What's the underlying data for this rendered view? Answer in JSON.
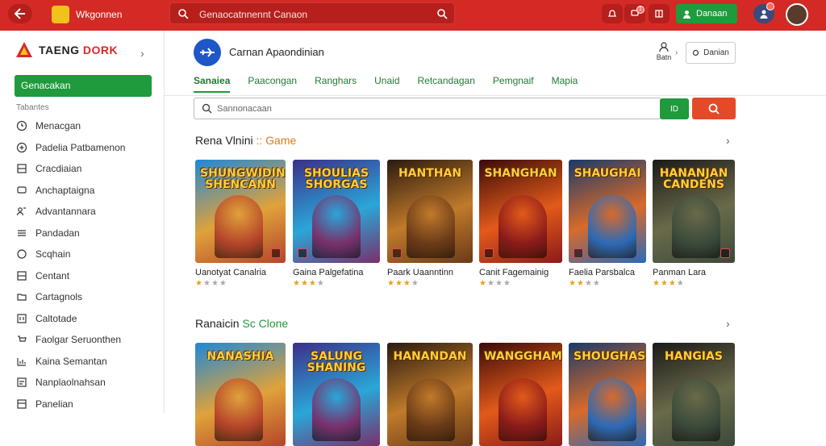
{
  "topbar": {
    "app_name": "Wkgonnen",
    "search_placeholder": "Genaocatnnennt Canaon",
    "signin_label": "Danaan",
    "notif_count": "1"
  },
  "sidebar": {
    "brand_a": "TAENG",
    "brand_b": "DORK",
    "active_item": "Genacakan",
    "section_label": "Tabantes",
    "items": [
      {
        "label": "Menacgan",
        "icon": "clock-icon"
      },
      {
        "label": "Padelia Patbamenon",
        "icon": "plus-circle-icon"
      },
      {
        "label": "Cracdiaian",
        "icon": "grid-icon"
      },
      {
        "label": "Anchaptaigna",
        "icon": "chat-icon"
      },
      {
        "label": "Advantannara",
        "icon": "users-icon"
      },
      {
        "label": "Pandadan",
        "icon": "list-icon"
      },
      {
        "label": "Scqhain",
        "icon": "refresh-icon"
      },
      {
        "label": "Centant",
        "icon": "grid-icon"
      },
      {
        "label": "Cartagnols",
        "icon": "folder-icon"
      },
      {
        "label": "Caltotade",
        "icon": "sliders-icon"
      },
      {
        "label": "Faolgar Seruonthen",
        "icon": "cart-icon"
      },
      {
        "label": "Kaina Semantan",
        "icon": "chart-icon"
      },
      {
        "label": "Nanplaolnahsan",
        "icon": "bars-icon"
      },
      {
        "label": "Panelian",
        "icon": "panel-icon"
      }
    ]
  },
  "header": {
    "title": "Carnan Apaondinian",
    "user_label": "Batn",
    "action_label": "Danian",
    "tabs": [
      "Sanaiea",
      "Paacongan",
      "Ranghars",
      "Unaid",
      "Retcandagan",
      "Pemgnaif",
      "Mapia"
    ]
  },
  "search": {
    "placeholder": "Sannonacaan",
    "green_btn": "ID"
  },
  "sections": [
    {
      "title_a": "Rena Vlnini",
      "title_b": ":: Game",
      "games": [
        {
          "art_title": "SHUNGWIDIN SHENCANN",
          "name": "Uanotyat Canalria",
          "stars": 1
        },
        {
          "art_title": "SHOULIAS SHORGAS",
          "name": "Gaina Palgefatina",
          "stars": 3
        },
        {
          "art_title": "HANTHAN",
          "name": "Paark Uaanntinn",
          "stars": 3
        },
        {
          "art_title": "SHANGHAN",
          "name": "Canit Fagemainig",
          "stars": 1
        },
        {
          "art_title": "SHAUGHAI",
          "name": "Faelia Parsbalca",
          "stars": 2
        },
        {
          "art_title": "HANANJAN CANDENS",
          "name": "Panman Lara",
          "stars": 3
        }
      ]
    },
    {
      "title_a": "Ranaicin",
      "title_b": "Sc Clone",
      "games": [
        {
          "art_title": "NANASHIA"
        },
        {
          "art_title": "SALUNG SHANING"
        },
        {
          "art_title": "HANANDAN"
        },
        {
          "art_title": "WANGGHAMANX"
        },
        {
          "art_title": "SHOUGHAS"
        },
        {
          "art_title": "HANGIAS"
        }
      ]
    }
  ],
  "colors": {
    "brand_red": "#d42a26",
    "accent_green": "#1f9a3c",
    "accent_orange": "#e44a28"
  }
}
